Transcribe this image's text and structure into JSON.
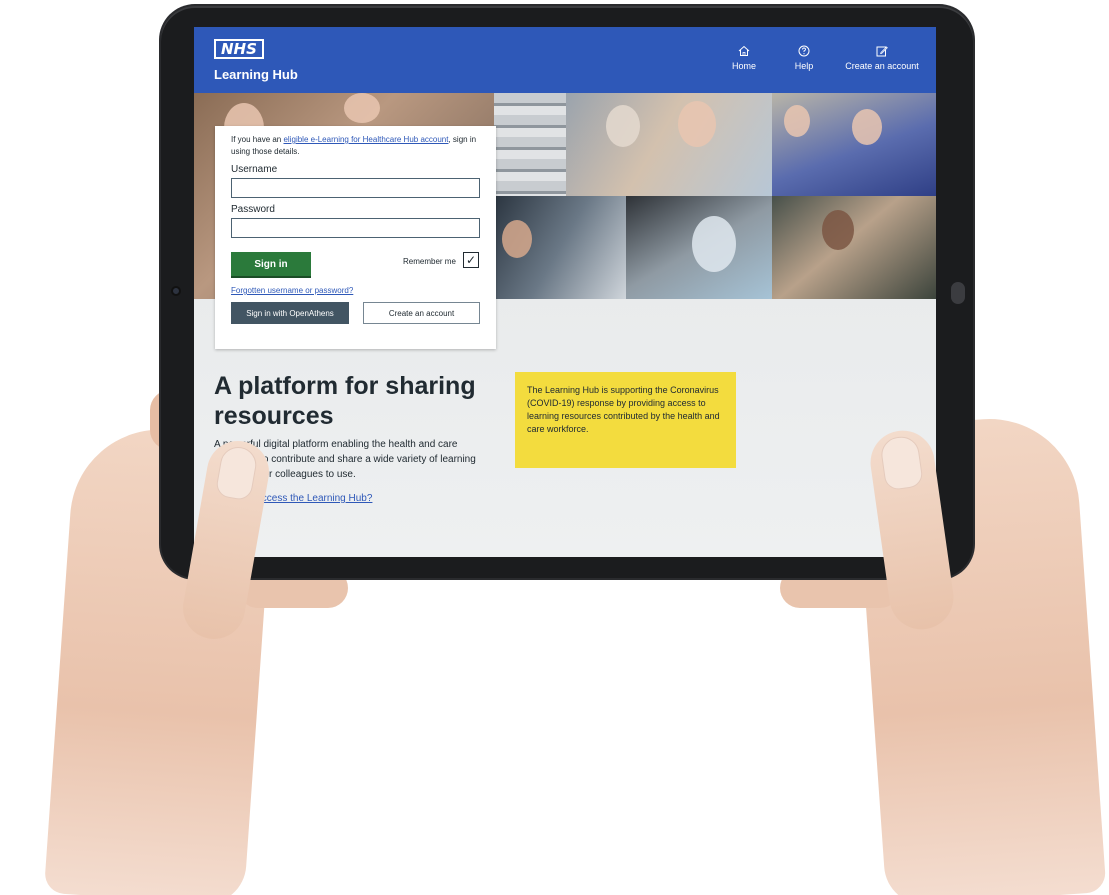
{
  "header": {
    "logo_text": "NHS",
    "title": "Learning Hub",
    "nav": [
      {
        "label": "Home",
        "icon": "home-icon"
      },
      {
        "label": "Help",
        "icon": "help-icon"
      },
      {
        "label": "Create an account",
        "icon": "edit-icon"
      }
    ]
  },
  "signin": {
    "intro_prefix": "If you have an ",
    "intro_link": "eligible e-Learning for Healthcare Hub account",
    "intro_suffix": ", sign in using those details.",
    "username_label": "Username",
    "username_value": "",
    "password_label": "Password",
    "password_value": "",
    "signin_button": "Sign in",
    "remember_label": "Remember me",
    "remember_checked": true,
    "forgot_link": "Forgotten username or password?",
    "openathens_button": "Sign in with OpenAthens",
    "create_button": "Create an account"
  },
  "main": {
    "heading": "A platform for sharing resources",
    "lead": "A powerful digital platform enabling the health and care workforce to contribute and share a wide variety of learning resources for colleagues to use.",
    "how_link": "Who can access the Learning Hub?"
  },
  "notice": {
    "text": "The Learning Hub is supporting the Coronavirus (COVID-19) response by providing access to learning resources contributed by the health and care workforce."
  },
  "colors": {
    "header_blue": "#2e58b8",
    "signin_green": "#2b7a3b",
    "notice_yellow": "#f3dc3e",
    "openathens_gray": "#425563"
  }
}
